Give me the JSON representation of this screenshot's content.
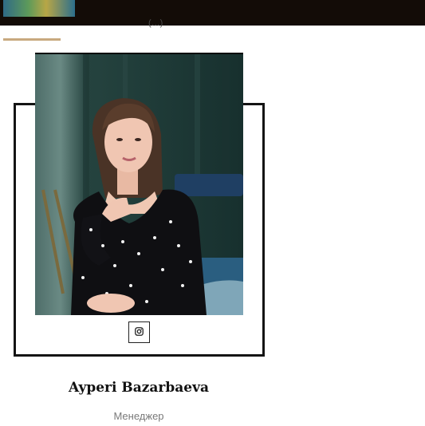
{
  "header": {
    "thumbnail_icon": "landscape-thumbnail",
    "cut_off_text": "(…)"
  },
  "colors": {
    "topbar": "#130c07",
    "accent": "#c8a97f",
    "frame": "#141414"
  },
  "team_member": {
    "photo_icon": "portrait-photo",
    "social": {
      "icon": "instagram-icon"
    },
    "name": "Ayperi Bazarbaeva",
    "role": "Менеджер"
  }
}
